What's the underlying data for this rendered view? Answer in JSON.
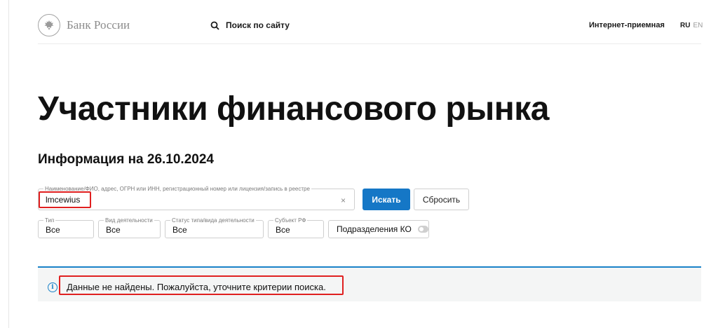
{
  "header": {
    "logo_text": "Банк России",
    "search_label": "Поиск по сайту",
    "reception_label": "Интернет-приемная",
    "lang_ru": "RU",
    "lang_en": "EN"
  },
  "page": {
    "title": "Участники финансового рынка",
    "info_date": "Информация на 26.10.2024"
  },
  "search": {
    "legend": "Наименование/ФИО, адрес, ОГРН или ИНН, регистрационный номер или лицензия/запись в реестре",
    "value": "lmcewius",
    "clear": "×",
    "search_button": "Искать",
    "reset_button": "Сбросить"
  },
  "filters": {
    "type": {
      "legend": "Тип",
      "value": "Все"
    },
    "activity": {
      "legend": "Вид деятельности",
      "value": "Все"
    },
    "status": {
      "legend": "Статус типа/вида деятельности",
      "value": "Все"
    },
    "region": {
      "legend": "Субъект РФ",
      "value": "Все"
    },
    "branches": {
      "label": "Подразделения КО",
      "enabled": false
    }
  },
  "notice": {
    "icon": "info-icon",
    "message": "Данные не найдены. Пожалуйста, уточните критерии поиска."
  },
  "colors": {
    "accent": "#1577c6",
    "highlight": "#e02020",
    "notice_bg": "#f4f5f5"
  }
}
